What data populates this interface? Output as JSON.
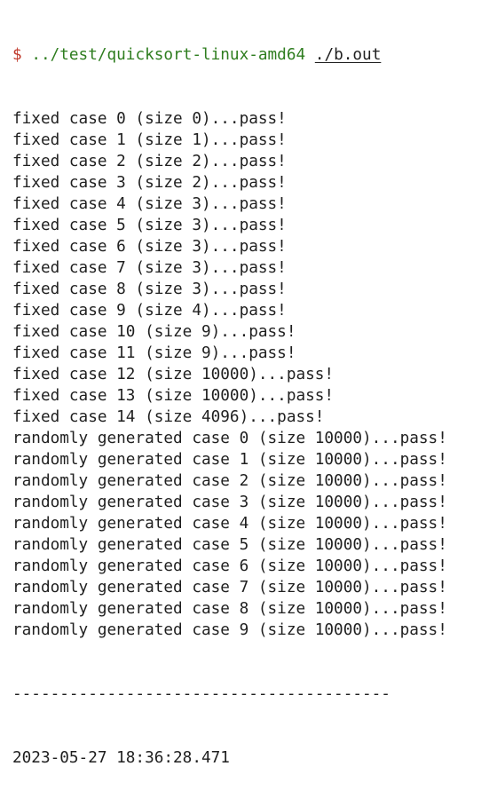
{
  "prompt": {
    "symbol": "$",
    "command_path": "../test/quicksort-linux-amd64",
    "argument": "./b.out"
  },
  "output_lines": [
    "fixed case 0 (size 0)...pass!",
    "fixed case 1 (size 1)...pass!",
    "fixed case 2 (size 2)...pass!",
    "fixed case 3 (size 2)...pass!",
    "fixed case 4 (size 3)...pass!",
    "fixed case 5 (size 3)...pass!",
    "fixed case 6 (size 3)...pass!",
    "fixed case 7 (size 3)...pass!",
    "fixed case 8 (size 3)...pass!",
    "fixed case 9 (size 4)...pass!",
    "fixed case 10 (size 9)...pass!",
    "fixed case 11 (size 9)...pass!",
    "fixed case 12 (size 10000)...pass!",
    "fixed case 13 (size 10000)...pass!",
    "fixed case 14 (size 4096)...pass!",
    "randomly generated case 0 (size 10000)...pass!",
    "randomly generated case 1 (size 10000)...pass!",
    "randomly generated case 2 (size 10000)...pass!",
    "randomly generated case 3 (size 10000)...pass!",
    "randomly generated case 4 (size 10000)...pass!",
    "randomly generated case 5 (size 10000)...pass!",
    "randomly generated case 6 (size 10000)...pass!",
    "randomly generated case 7 (size 10000)...pass!",
    "randomly generated case 8 (size 10000)...pass!",
    "randomly generated case 9 (size 10000)...pass!"
  ],
  "separator": "----------------------------------------",
  "timestamp": "2023-05-27 18:36:28.471",
  "colors": {
    "prompt_symbol": "#c0392b",
    "command_path": "#2e7d1f",
    "text": "#1f1f1f",
    "background": "#ffffff"
  }
}
